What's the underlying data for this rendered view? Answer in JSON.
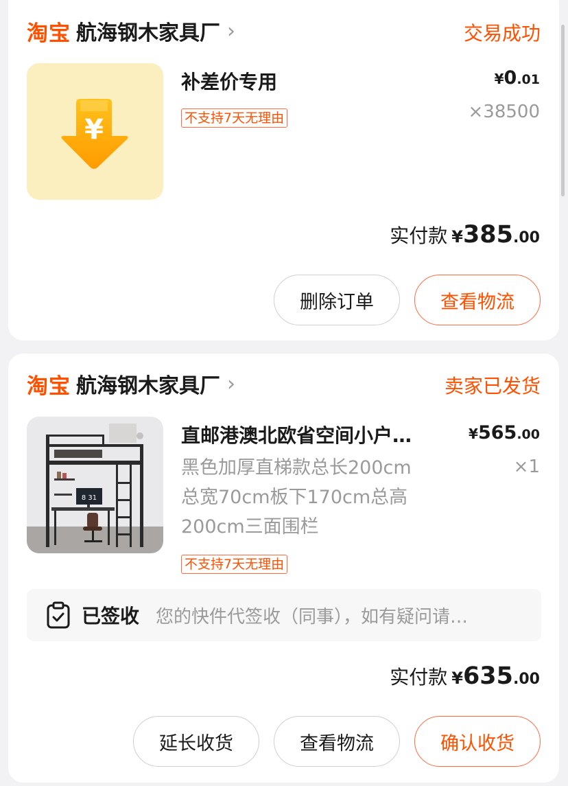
{
  "orders": [
    {
      "brand": "淘宝",
      "shop_name": "航海钢木家具厂",
      "status": "交易成功",
      "product": {
        "image_icon": "yen-down-arrow-icon",
        "title": "补差价专用",
        "price_symbol": "¥",
        "price_int": "0",
        "price_dec": ".01",
        "quantity": "×38500",
        "tag": "不支持7天无理由"
      },
      "paid_label": "实付款",
      "paid_symbol": "¥",
      "paid_int": "385",
      "paid_dec": ".00",
      "buttons": [
        "删除订单",
        "查看物流"
      ]
    },
    {
      "brand": "淘宝",
      "shop_name": "航海钢木家具厂",
      "status": "卖家已发货",
      "product": {
        "image_icon": "loft-bed-photo",
        "title": "直邮港澳北欧省空间小户…",
        "price_symbol": "¥",
        "price_int": "565",
        "price_dec": ".00",
        "quantity": "×1",
        "spec_lines": [
          "黑色加厚直梯款总长200cm",
          "总宽70cm板下170cm总高",
          "200cm三面围栏"
        ],
        "tag": "不支持7天无理由"
      },
      "logistics": {
        "icon": "clipboard-check-icon",
        "label": "已签收",
        "text": "您的快件代签收（同事），如有疑问请…"
      },
      "paid_label": "实付款",
      "paid_symbol": "¥",
      "paid_int": "635",
      "paid_dec": ".00",
      "buttons": [
        "延长收货",
        "查看物流",
        "确认收货"
      ]
    }
  ],
  "colors": {
    "accent": "#ff5000",
    "background": "#f2f2f4",
    "muted_text": "#9a9a9a"
  }
}
